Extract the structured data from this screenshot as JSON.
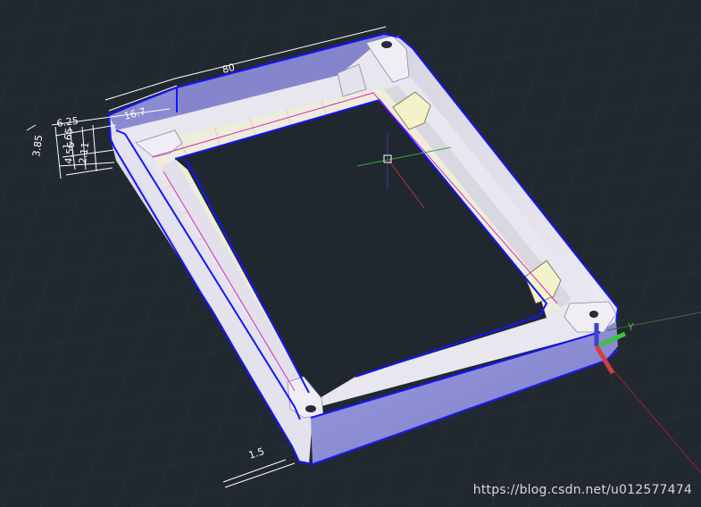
{
  "dimensions": {
    "length_top": "80",
    "width_left": "6.25",
    "offset_a": "16.7",
    "height_a": "3.85",
    "height_b": "1.65",
    "height_c": "4.56",
    "height_d": "2.11",
    "wall_bottom": "1.5"
  },
  "ucs_axis_label": "Y",
  "watermark": "https://blog.csdn.net/u012577474",
  "colors": {
    "background": "#212830",
    "wall_side": "#8787cc",
    "wall_top": "#e6e3ec",
    "inner_ledge": "#f0eedc",
    "edge_highlight": "#1010ff",
    "axis_x": "#cc3333",
    "axis_y": "#33bb33",
    "axis_z": "#3333cc"
  }
}
